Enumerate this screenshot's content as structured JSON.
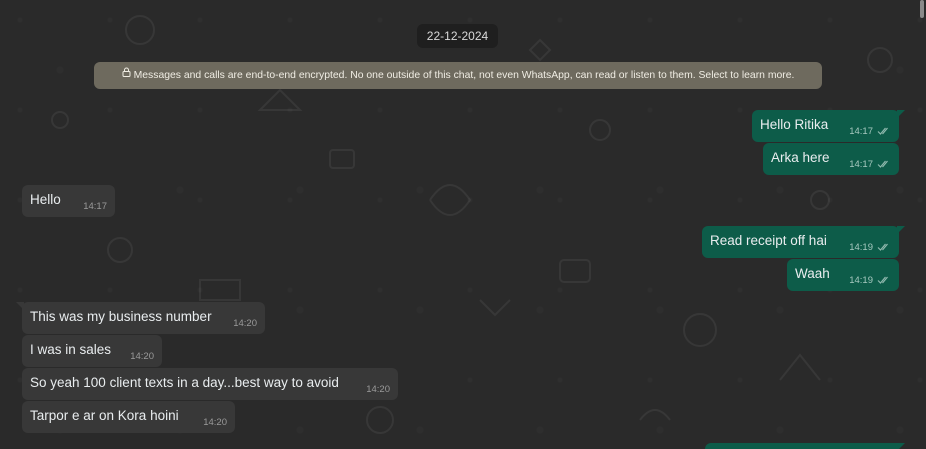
{
  "date_chip": "22-12-2024",
  "encryption_notice": "Messages and calls are end-to-end encrypted. No one outside of this chat, not even WhatsApp, can read or listen to them. Select to learn more.",
  "messages": [
    {
      "text": "Hello Ritika",
      "time": "14:17",
      "direction": "out",
      "status": "read-receipt-icon"
    },
    {
      "text": "Arka here",
      "time": "14:17",
      "direction": "out",
      "status": "read-receipt-icon"
    },
    {
      "text": "Hello",
      "time": "14:17",
      "direction": "in"
    },
    {
      "text": "Read receipt off hai",
      "time": "14:19",
      "direction": "out",
      "status": "read-receipt-icon"
    },
    {
      "text": "Waah",
      "time": "14:19",
      "direction": "out",
      "status": "read-receipt-icon"
    },
    {
      "text": "This was my business number",
      "time": "14:20",
      "direction": "in"
    },
    {
      "text": "I was in sales",
      "time": "14:20",
      "direction": "in"
    },
    {
      "text": "So yeah 100 client texts in a day...best way to avoid",
      "time": "14:20",
      "direction": "in"
    },
    {
      "text": "Tarpor e ar on Kora hoini",
      "time": "14:20",
      "direction": "in"
    }
  ],
  "colors": {
    "background": "#2a2a2a",
    "incoming_bubble": "#383838",
    "outgoing_bubble": "#0d5c49",
    "notice_bg": "#6e6a5e",
    "date_chip_bg": "#1f1f1f"
  }
}
